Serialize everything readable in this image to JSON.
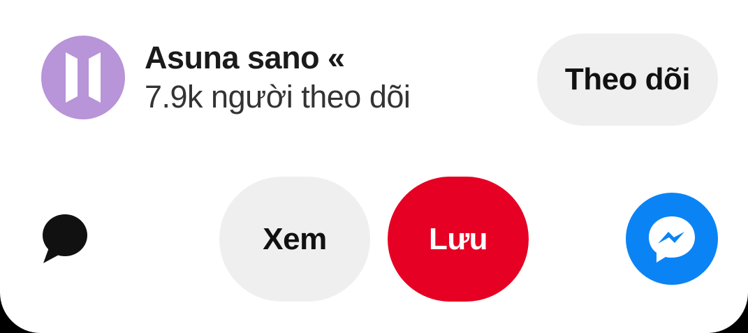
{
  "profile": {
    "name": "Asuna sano «",
    "followers_text": "7.9k người theo dõi",
    "avatar_icon": "bts-logo-icon",
    "avatar_color": "#b894d8"
  },
  "actions": {
    "follow_label": "Theo dõi",
    "view_label": "Xem",
    "save_label": "Lưu",
    "comment_icon": "speech-bubble-icon",
    "share_icon": "messenger-icon"
  },
  "colors": {
    "save_button": "#e60023",
    "neutral_button": "#efefef",
    "messenger": "#0a84f5"
  }
}
